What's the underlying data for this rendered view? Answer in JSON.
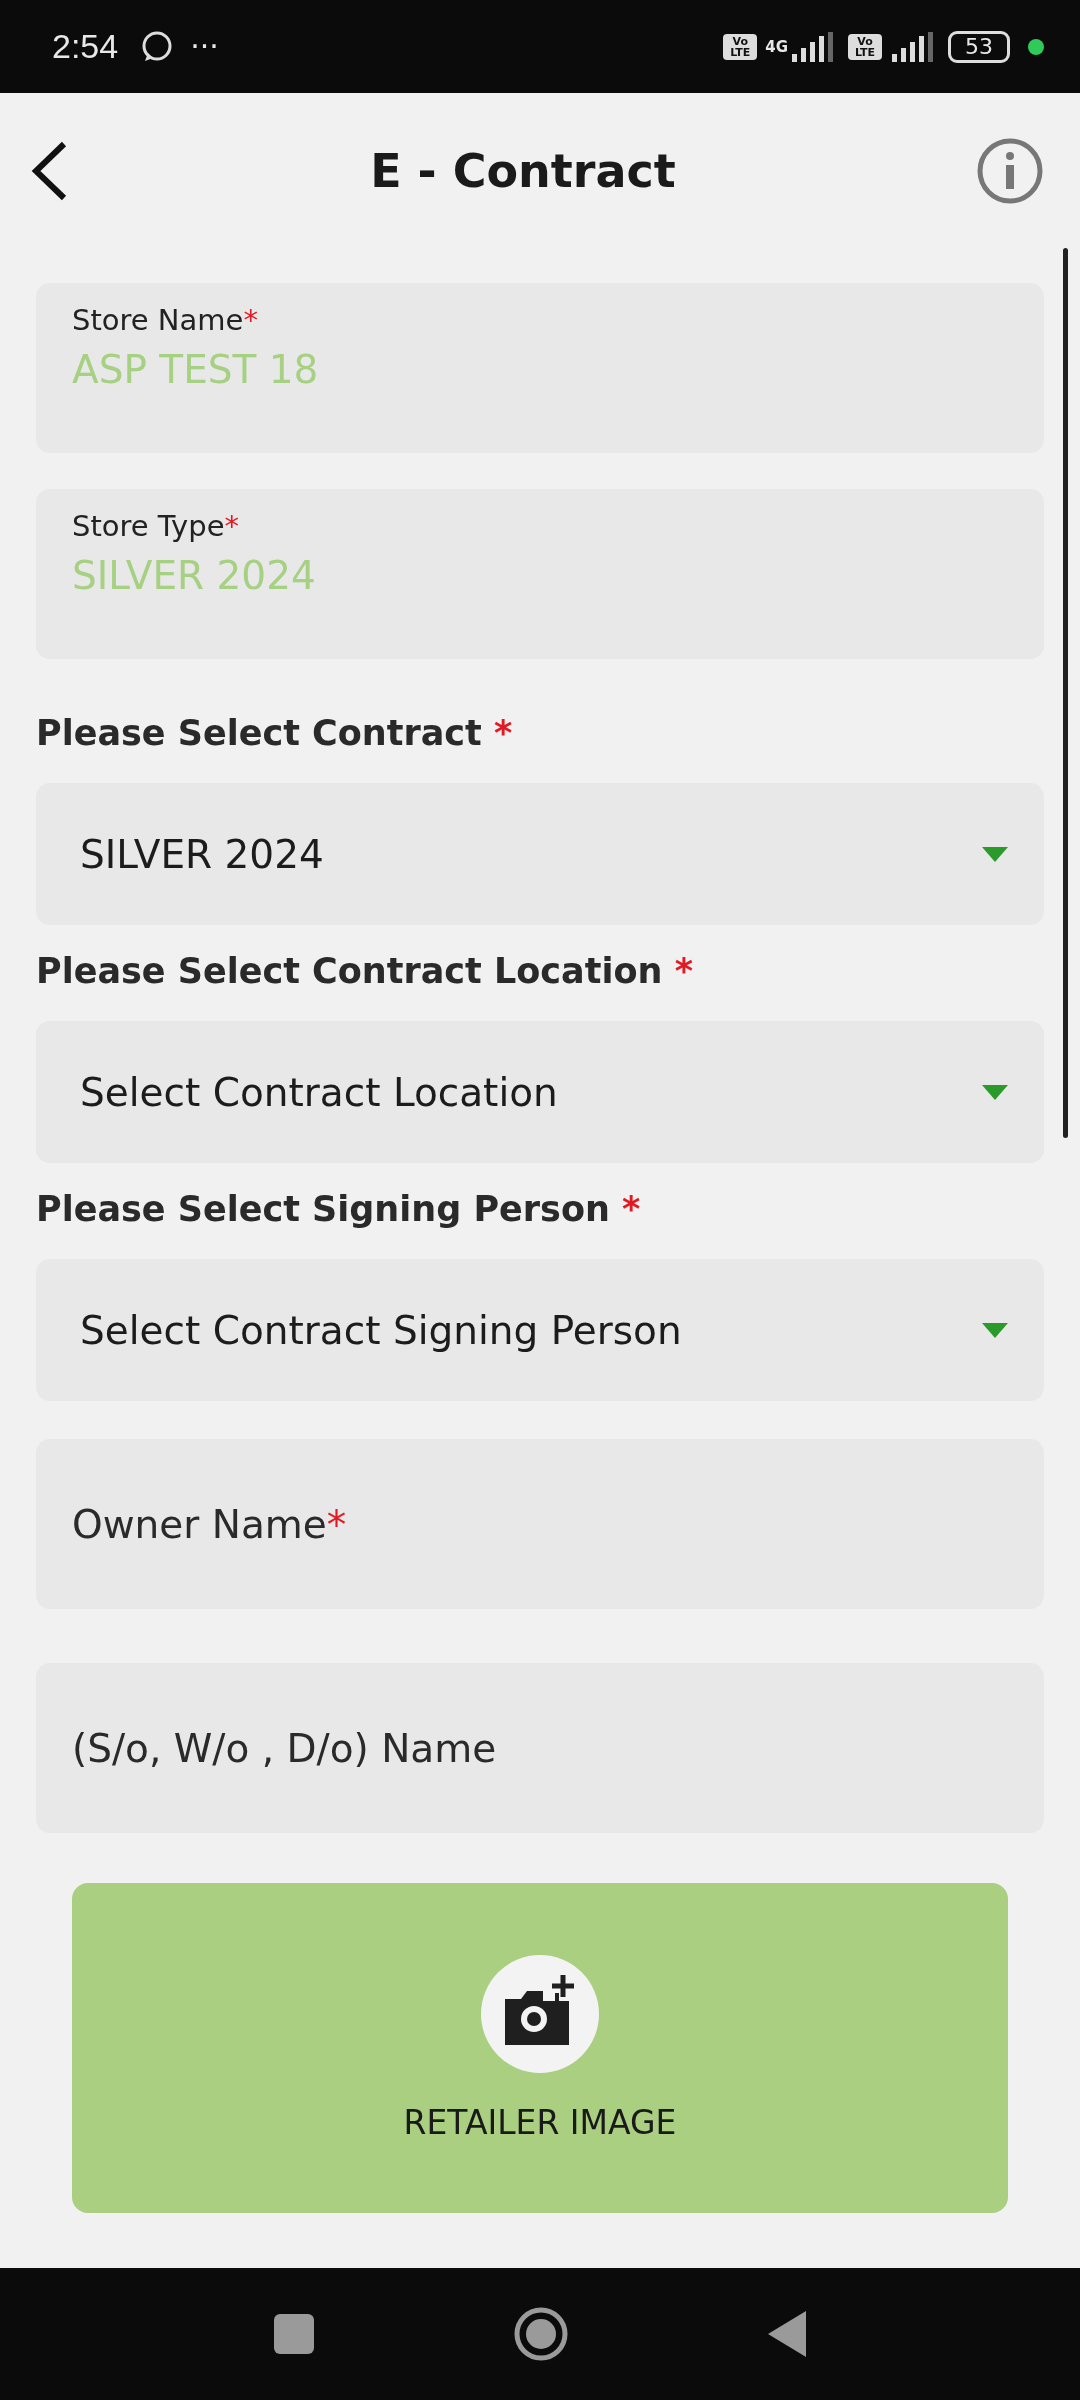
{
  "status_bar": {
    "time": "2:54",
    "more": "···",
    "sim1": "Vo LTE",
    "network": "4G",
    "sim2": "Vo LTE",
    "battery": "53"
  },
  "header": {
    "title": "E - Contract"
  },
  "form": [
    {
      "kind": "readonly",
      "label": "Store Name",
      "required_mark": "*",
      "value": "ASP TEST 18"
    },
    {
      "kind": "readonly",
      "label": "Store Type",
      "required_mark": "*",
      "value": "SILVER 2024"
    },
    {
      "kind": "select",
      "label": "Please Select Contract",
      "required_mark": "*",
      "value": "SILVER 2024"
    },
    {
      "kind": "select",
      "label": "Please Select Contract Location",
      "required_mark": "*",
      "value": "Select Contract Location"
    },
    {
      "kind": "select",
      "label": "Please Select Signing Person",
      "required_mark": "*",
      "value": "Select Contract Signing Person"
    },
    {
      "kind": "input",
      "placeholder": "Owner Name",
      "required_mark": "*"
    },
    {
      "kind": "input",
      "placeholder": "(S/o, W/o , D/o) Name"
    }
  ],
  "upload": {
    "label": "RETAILER IMAGE"
  }
}
